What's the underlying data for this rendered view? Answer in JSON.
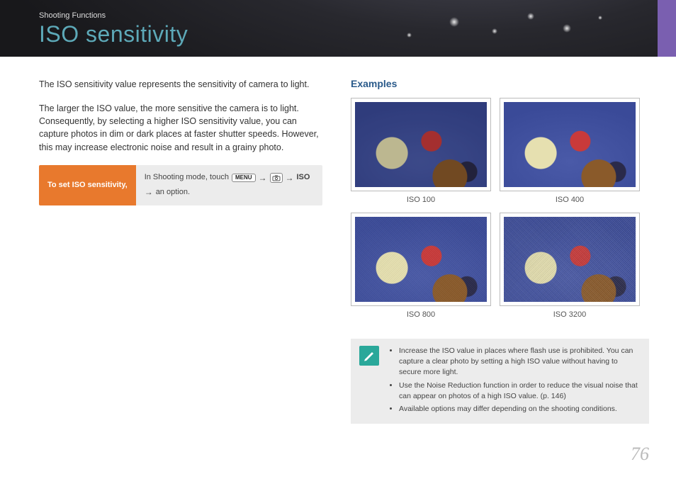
{
  "header": {
    "breadcrumb": "Shooting Functions",
    "title": "ISO sensitivity"
  },
  "intro": {
    "p1": "The ISO sensitivity value represents the sensitivity of camera to light.",
    "p2": "The larger the ISO value, the more sensitive the camera is to light. Consequently, by selecting a higher ISO sensitivity value, you can capture photos in dim or dark places at faster shutter speeds. However, this may increase electronic noise and result in a grainy photo."
  },
  "instruction": {
    "label": "To set ISO sensitivity,",
    "prefix": "In Shooting mode, touch",
    "menu_chip": "MENU",
    "arrow": "→",
    "iso_bold": "ISO",
    "suffix": "an option."
  },
  "examples": {
    "heading": "Examples",
    "items": [
      {
        "caption": "ISO 100"
      },
      {
        "caption": "ISO 400"
      },
      {
        "caption": "ISO 800"
      },
      {
        "caption": "ISO 3200"
      }
    ]
  },
  "tips": {
    "items": [
      "Increase the ISO value in places where flash use is prohibited. You can capture a clear photo by setting a high ISO value without having to secure more light.",
      "Use the Noise Reduction function in order to reduce the visual noise that can appear on photos of a high ISO value. (p. 146)",
      "Available options may differ depending on the shooting conditions."
    ]
  },
  "page_number": "76"
}
